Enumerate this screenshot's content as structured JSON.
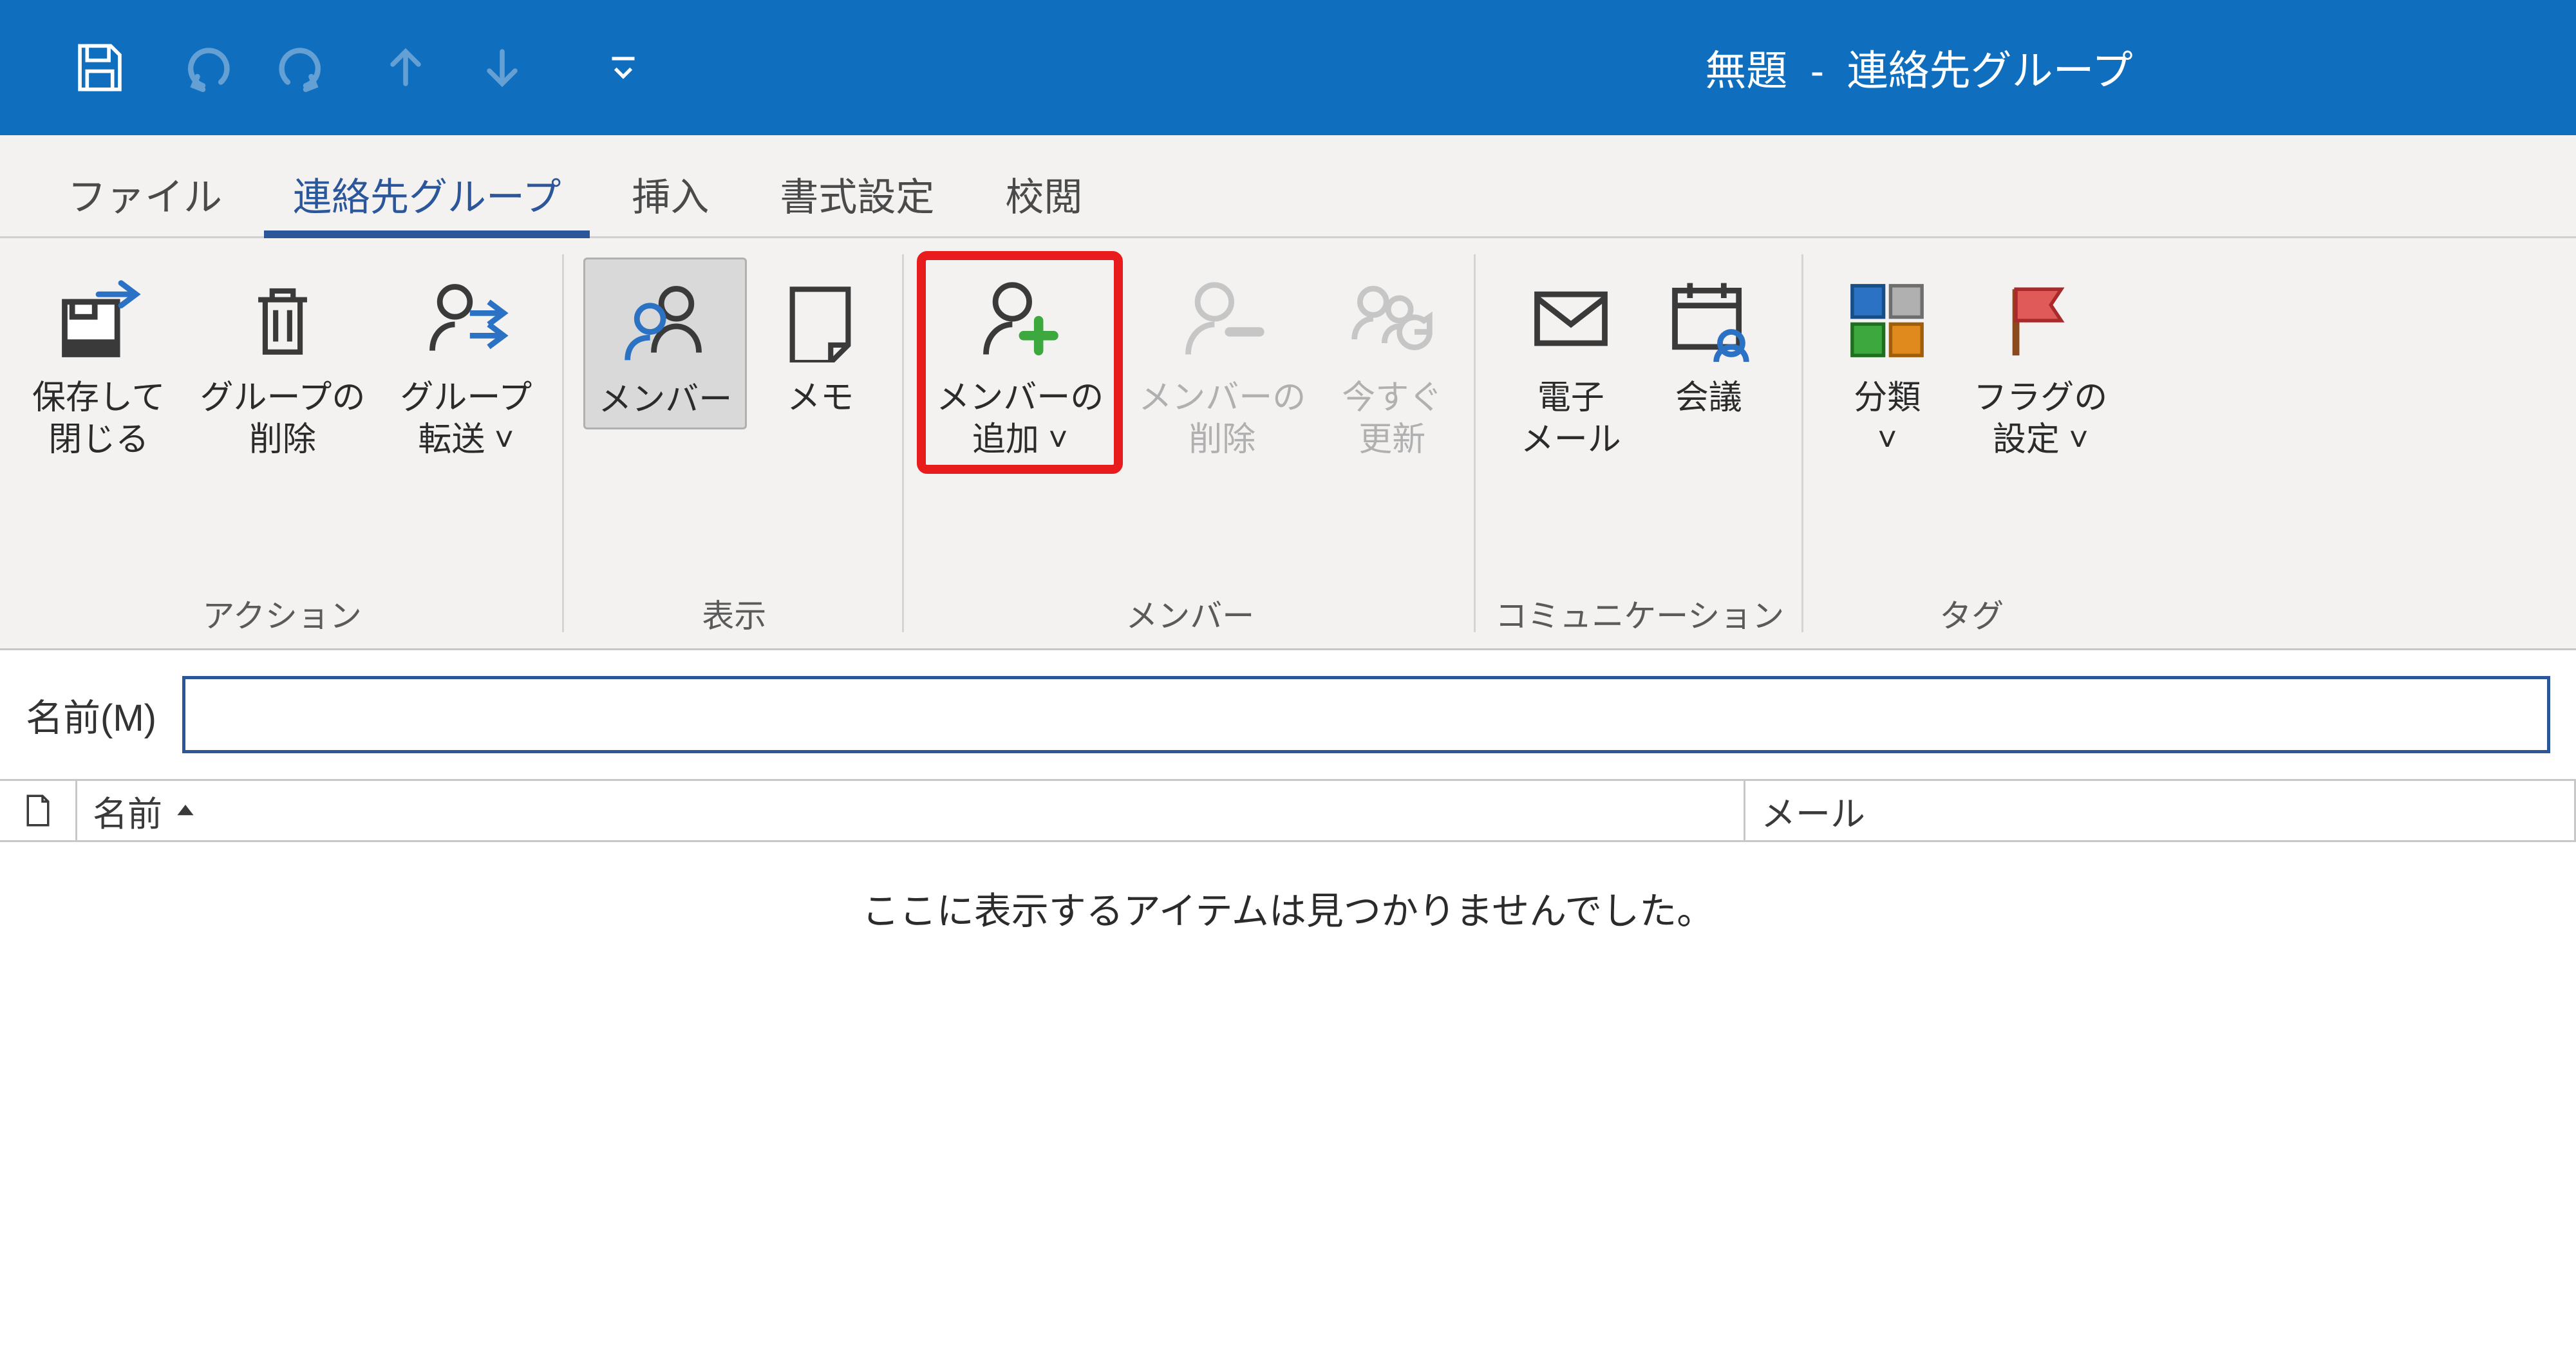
{
  "title": "無題  -  連絡先グループ",
  "tabs": {
    "file": "ファイル",
    "contact_group": "連絡先グループ",
    "insert": "挿入",
    "format": "書式設定",
    "review": "校閲"
  },
  "ribbon": {
    "actions": {
      "label": "アクション",
      "save_close": "保存して\n閉じる",
      "delete_group": "グループの\n削除",
      "forward_group": "グループ\n転送 ˅"
    },
    "show": {
      "label": "表示",
      "members": "メンバー",
      "notes": "メモ"
    },
    "members": {
      "label": "メンバー",
      "add_member": "メンバーの\n追加 ˅",
      "remove_member": "メンバーの\n削除",
      "update_now": "今すぐ\n更新"
    },
    "communication": {
      "label": "コミュニケーション",
      "email": "電子\nメール",
      "meeting": "会議"
    },
    "tags": {
      "label": "タグ",
      "categorize": "分類\n˅",
      "flag": "フラグの\n設定 ˅"
    }
  },
  "name_field": {
    "label": "名前(M)",
    "value": ""
  },
  "columns": {
    "name": "名前",
    "mail": "メール"
  },
  "empty_message": "ここに表示するアイテムは見つかりませんでした。"
}
